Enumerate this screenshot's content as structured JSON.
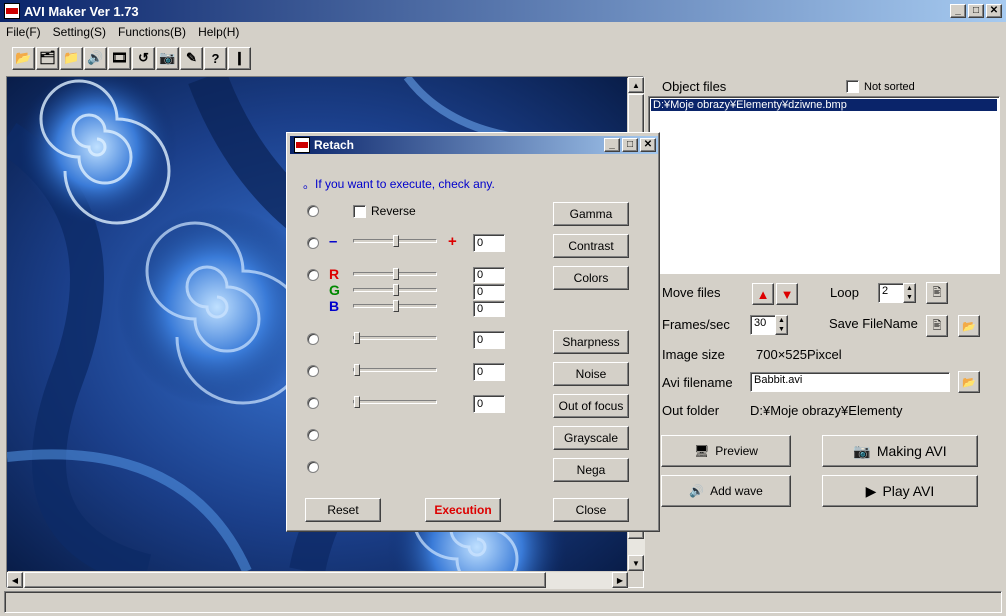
{
  "window": {
    "title": "AVI Maker Ver 1.73"
  },
  "menu": [
    "File(F)",
    "Setting(S)",
    "Functions(B)",
    "Help(H)"
  ],
  "toolbar": [
    {
      "icon": "open-folder-icon",
      "glyph": "📂"
    },
    {
      "icon": "open-folders-icon",
      "glyph": "🗂"
    },
    {
      "icon": "folder-icon",
      "glyph": "📁"
    },
    {
      "icon": "sound-icon",
      "glyph": "🔊"
    },
    {
      "icon": "film-icon",
      "glyph": "🎞"
    },
    {
      "icon": "retach-icon",
      "glyph": "↺"
    },
    {
      "icon": "camera-icon",
      "glyph": "📷"
    },
    {
      "icon": "edit-icon",
      "glyph": "✎"
    },
    {
      "icon": "help-icon",
      "glyph": "?"
    },
    {
      "icon": "exit-icon",
      "glyph": "❙"
    }
  ],
  "right": {
    "object_files_label": "Object files",
    "not_sorted_label": "Not sorted",
    "files": [
      "D:¥Moje obrazy¥Elementy¥dziwne.bmp"
    ],
    "move_files_label": "Move files",
    "loop_label": "Loop",
    "loop_value": "2",
    "frames_label": "Frames/sec",
    "frames_value": "30",
    "save_filename_label": "Save FileName",
    "image_size_label": "Image size",
    "image_size_value": "700×525Pixcel",
    "avi_filename_label": "Avi filename",
    "avi_filename_value": "Babbit.avi",
    "out_folder_label": "Out folder",
    "out_folder_value": "D:¥Moje obrazy¥Elementy",
    "preview_label": "Preview",
    "making_label": "Making AVI",
    "add_wave_label": "Add wave",
    "play_label": "Play AVI"
  },
  "dialog": {
    "title": "Retach",
    "hint": "。If you want to execute,  check any.",
    "reverse_label": "Reverse",
    "minus": "–",
    "plus": "+",
    "r_label": "R",
    "g_label": "G",
    "b_label": "B",
    "values": {
      "contrast": "0",
      "r": "0",
      "g": "0",
      "b": "0",
      "sharpness": "0",
      "noise": "0",
      "focus": "0"
    },
    "buttons": {
      "gamma": "Gamma",
      "contrast": "Contrast",
      "colors": "Colors",
      "sharpness": "Sharpness",
      "noise": "Noise",
      "focus": "Out of focus",
      "grayscale": "Grayscale",
      "nega": "Nega"
    },
    "reset_label": "Reset",
    "execute_label": "Execution",
    "close_label": "Close",
    "colors": {
      "hint": "#0000cc",
      "minus": "#0000cc",
      "plus": "#dd0000",
      "r": "#dd0000",
      "g": "#008800",
      "b": "#0000cc",
      "execute": "#dd0000"
    }
  }
}
